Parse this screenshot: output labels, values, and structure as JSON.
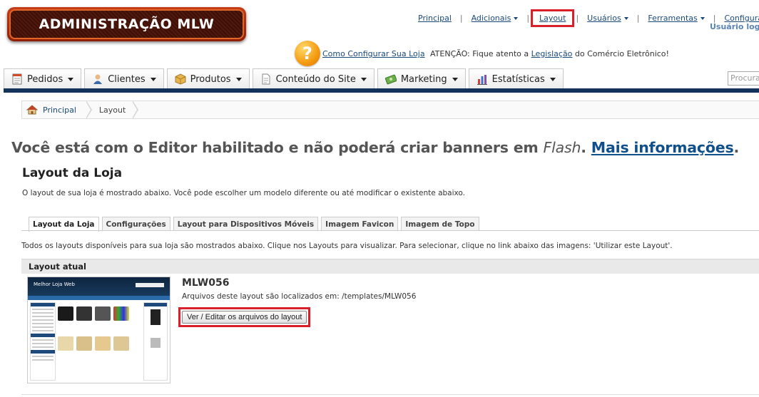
{
  "logo": {
    "text": "ADMINISTRAÇÃO MLW"
  },
  "topnav": {
    "items": [
      {
        "label": "Principal",
        "dropdown": false
      },
      {
        "label": "Adicionais",
        "dropdown": true
      },
      {
        "label": "Layout",
        "dropdown": false,
        "highlighted": true
      },
      {
        "label": "Usuários",
        "dropdown": true
      },
      {
        "label": "Ferramentas",
        "dropdown": true
      },
      {
        "label": "Configurações",
        "dropdown": true
      }
    ],
    "separator": "|",
    "user_text": "Usuário loga"
  },
  "help": {
    "icon": "question-icon",
    "link": "Como Configurar Sua Loja",
    "attention_prefix": "ATENÇÃO: Fique atento a ",
    "attention_link": "Legislação",
    "attention_suffix": " do Comércio Eletrônico!"
  },
  "mainmenu": {
    "items": [
      {
        "label": "Pedidos",
        "icon": "orders-icon"
      },
      {
        "label": "Clientes",
        "icon": "customers-icon"
      },
      {
        "label": "Produtos",
        "icon": "products-icon"
      },
      {
        "label": "Conteúdo do Site",
        "icon": "content-icon"
      },
      {
        "label": "Marketing",
        "icon": "marketing-icon"
      },
      {
        "label": "Estatísticas",
        "icon": "statistics-icon"
      }
    ],
    "search_placeholder": "Procurar"
  },
  "breadcrumb": {
    "home": "Principal",
    "current": "Layout"
  },
  "flash_warning": {
    "prefix": "Você está com o Editor habilitado e não poderá criar banners em ",
    "emphasis": "Flash",
    "middle": ". ",
    "link": "Mais informações",
    "suffix": "."
  },
  "page": {
    "title": "Layout da Loja",
    "description": "O layout de sua loja é mostrado abaixo. Você pode escolher um modelo diferente ou até modificar o existente abaixo."
  },
  "tabs": [
    {
      "label": "Layout da Loja",
      "active": true
    },
    {
      "label": "Configurações",
      "active": false
    },
    {
      "label": "Layout para Dispositivos Móveis",
      "active": false
    },
    {
      "label": "Imagem Favicon",
      "active": false
    },
    {
      "label": "Imagem de Topo",
      "active": false
    }
  ],
  "layouts_description": "Todos os layouts disponíveis para sua loja são mostrados abaixo. Clique nos Layouts para visualizar. Para selecionar, clique no link abaixo das imagens: 'Utilizar este Layout'.",
  "current_layout": {
    "header": "Layout atual",
    "thumbnail_title": "Melhor Loja Web",
    "name": "MLW056",
    "path_text": "Arquivos deste layout são localizados em: /templates/MLW056",
    "edit_button": "Ver / Editar os arquivos do layout"
  },
  "colors": {
    "accent_red": "#d8202a",
    "navy": "#13335a",
    "link": "#1a4a7a"
  }
}
